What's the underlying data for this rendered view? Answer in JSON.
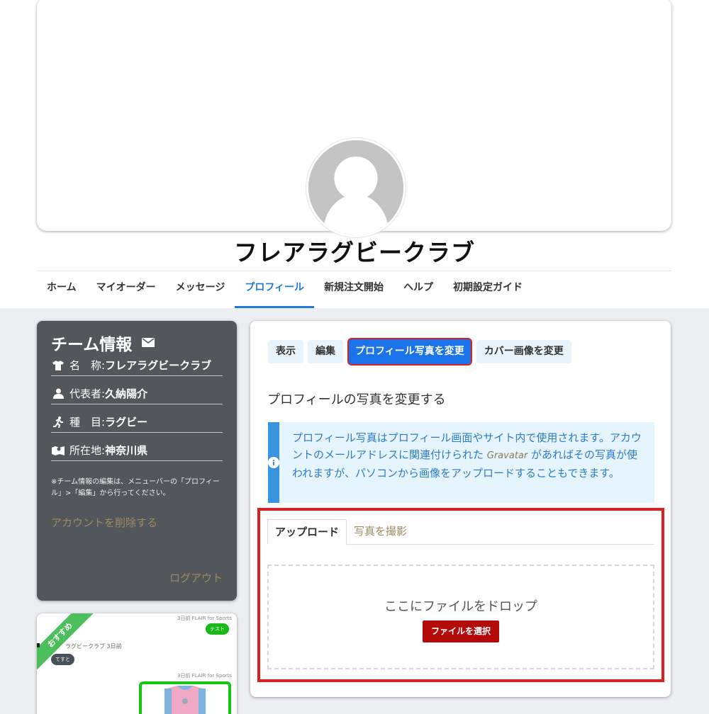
{
  "team": {
    "title": "フレアラグビークラブ"
  },
  "nav": {
    "items": [
      "ホーム",
      "マイオーダー",
      "メッセージ",
      "プロフィール",
      "新規注文開始",
      "ヘルプ",
      "初期設定ガイド"
    ],
    "active_index": 3
  },
  "team_card": {
    "title": "チーム情報",
    "rows": [
      {
        "icon": "shirt-icon",
        "label": "名　称:",
        "value": "フレアラグビークラブ"
      },
      {
        "icon": "person-icon",
        "label": "代表者:",
        "value": "久納陽介"
      },
      {
        "icon": "runner-icon",
        "label": "種　目:",
        "value": "ラグビー"
      },
      {
        "icon": "map-icon",
        "label": "所在地:",
        "value": "神奈川県"
      }
    ],
    "note": "※チーム情報の編集は、メニューバーの「プロフィール」>「編集」から行ってください。",
    "delete_label": "アカウントを削除する",
    "logout_label": "ログアウト"
  },
  "reco": {
    "ribbon": "おすすめ",
    "meta_top": "3日前 FLAIR for Sports",
    "bubble_green": "テスト",
    "name": "ラグビークラブ 3日前",
    "bubble_dark": "てすと",
    "meta_bottom": "3日前 FLAIR for Sports"
  },
  "profile": {
    "tabs": [
      "表示",
      "編集",
      "プロフィール写真を変更",
      "カバー画像を変更"
    ],
    "active_tab": 2,
    "heading": "プロフィールの写真を変更する",
    "alert_part1": "プロフィール写真はプロフィール画面やサイト内で使用されます。アカウントのメールアドレスに関連付けられた ",
    "alert_gravatar": "Gravatar",
    "alert_part2": " があればその写真が使われますが、パソコンから画像をアップロードすることもできます。",
    "upload_tabs": [
      "アップロード",
      "写真を撮影"
    ],
    "drop_text": "ここにファイルをドロップ",
    "choose_button": "ファイルを選択"
  },
  "colors": {
    "accent": "#1e7ad8",
    "card_dark": "#53575c",
    "highlight_red": "#df1f1f",
    "button_red": "#b50a0a"
  }
}
